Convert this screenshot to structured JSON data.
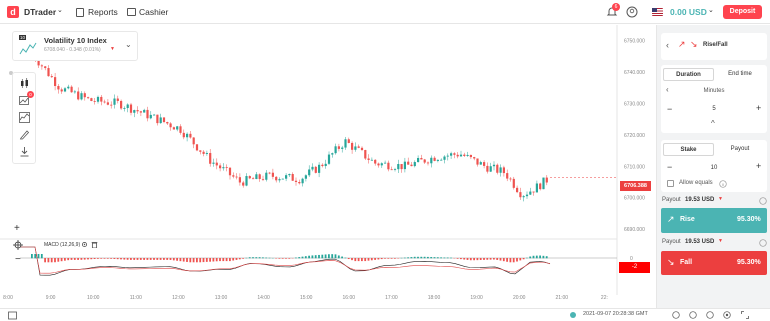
{
  "header": {
    "brand": "DTrader",
    "reports": "Reports",
    "cashier": "Cashier",
    "notifications_count": "6",
    "balance": "0.00 USD",
    "deposit": "Deposit"
  },
  "market": {
    "name": "Volatility 10 Index",
    "price_line": "6708.040 - 0.348 (0.01%)",
    "badge": "10"
  },
  "tools": {
    "notification_badge": "0"
  },
  "macd": {
    "label": "MACD (12,26,9)",
    "value": "-2"
  },
  "chart_data": {
    "type": "candlestick",
    "current_price": "6706.388",
    "y_ticks": [
      "6750.000",
      "6740.000",
      "6730.000",
      "6720.000",
      "6710.000",
      "6700.000",
      "6690.000"
    ],
    "x_ticks": [
      "8:00",
      "9:00",
      "10:00",
      "11:00",
      "12:00",
      "13:00",
      "14:00",
      "15:00",
      "16:00",
      "17:00",
      "18:00",
      "19:00",
      "20:00",
      "21:00",
      "22:"
    ],
    "ylim": [
      6687.5,
      6755
    ],
    "macd_ticks": [
      "0"
    ],
    "up_color": "#26a69a",
    "down_color": "#ef5350"
  },
  "trade": {
    "contract_type": "Rise/Fall",
    "duration_tab": "Duration",
    "endtime_tab": "End time",
    "unit": "Minutes",
    "duration_value": "5",
    "stake_tab": "Stake",
    "payout_tab": "Payout",
    "stake_value": "10",
    "allow_equals": "Allow equals",
    "rise_payout_label": "Payout",
    "rise_payout_value": "19.53 USD",
    "rise_button": "Rise",
    "rise_percent": "95.30%",
    "fall_payout_label": "Payout",
    "fall_payout_value": "19.53 USD",
    "fall_button": "Fall",
    "fall_percent": "95.30%"
  },
  "footer": {
    "time": "2021-09-07 20:28:38 GMT"
  }
}
